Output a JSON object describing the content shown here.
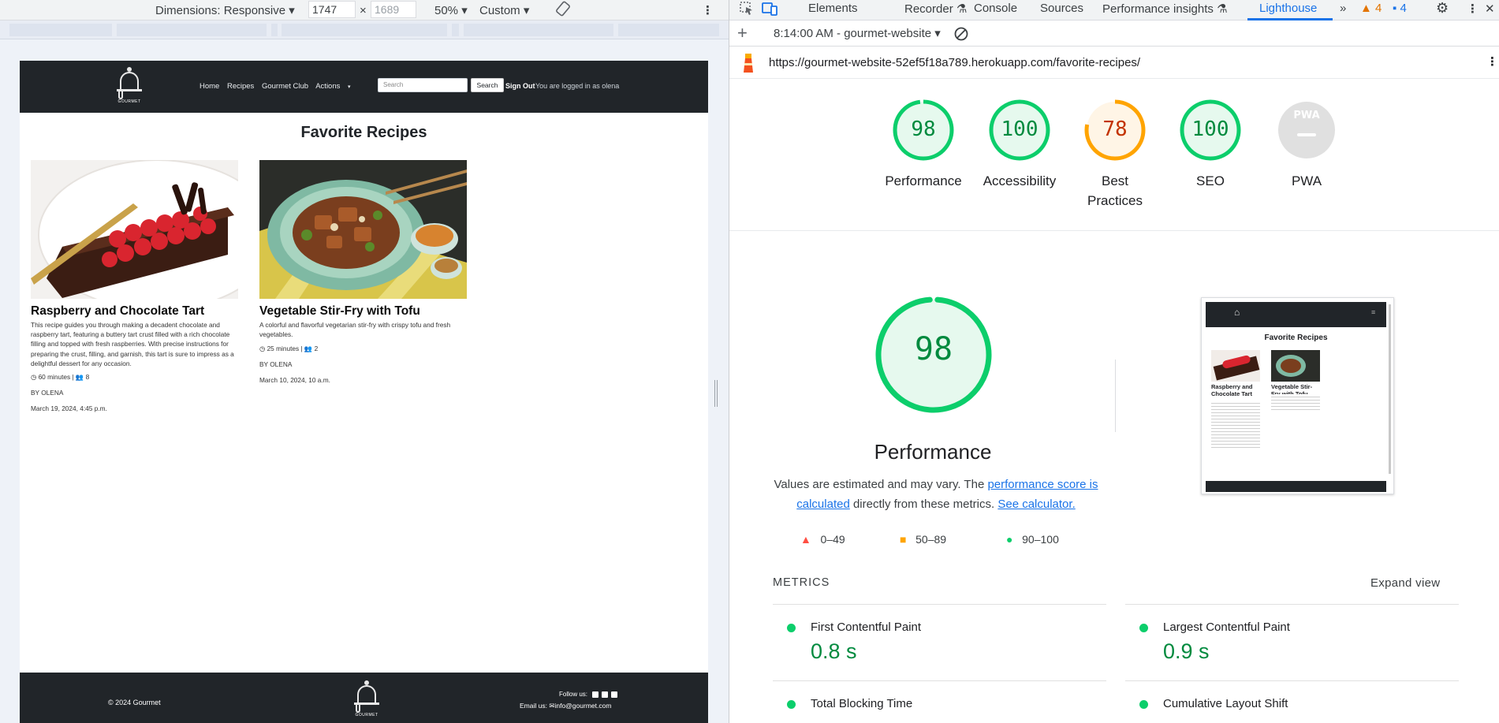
{
  "device_toolbar": {
    "dimensions_label": "Dimensions: Responsive",
    "width_value": "1747",
    "times": "×",
    "height_placeholder": "1689",
    "zoom": "50%",
    "throttle": "Custom"
  },
  "site": {
    "logo_text": "GOURMET",
    "nav": [
      "Home",
      "Recipes",
      "Gourmet Club",
      "Actions"
    ],
    "search_placeholder": "Search",
    "search_button": "Search",
    "sign_out": "Sign Out",
    "logged_in": "You are logged in as olena",
    "page_title": "Favorite Recipes",
    "recipes": [
      {
        "title": "Raspberry and Chocolate Tart",
        "description": "This recipe guides you through making a decadent chocolate and raspberry tart, featuring a buttery tart crust filled with a rich chocolate filling and topped with fresh raspberries. With precise instructions for preparing the crust, filling, and garnish, this tart is sure to impress as a delightful dessert for any occasion.",
        "time": "60 minutes",
        "servings": "8",
        "author": "BY OLENA",
        "date": "March 19, 2024, 4:45 p.m."
      },
      {
        "title": "Vegetable Stir-Fry with Tofu",
        "description": "A colorful and flavorful vegetarian stir-fry with crispy tofu and fresh vegetables.",
        "time": "25 minutes",
        "servings": "2",
        "author": "BY OLENA",
        "date": "March 10, 2024, 10 a.m."
      }
    ],
    "footer_copy": "© 2024 Gourmet",
    "footer_follow": "Follow us:",
    "footer_email_label": "Email us:",
    "footer_email": "info@gourmet.com"
  },
  "devtools": {
    "tabs": [
      "Elements",
      "Recorder",
      "Console",
      "Sources",
      "Performance insights",
      "Lighthouse"
    ],
    "warnings_count": "4",
    "messages_count": "4",
    "report_time": "8:14:00 AM - gourmet-website",
    "url": "https://gourmet-website-52ef5f18a789.herokuapp.com/favorite-recipes/",
    "scores": [
      {
        "label": "Performance",
        "value": "98",
        "score": 98,
        "status": "pass"
      },
      {
        "label": "Accessibility",
        "value": "100",
        "score": 100,
        "status": "pass"
      },
      {
        "label": "Best Practices",
        "value": "78",
        "score": 78,
        "status": "average"
      },
      {
        "label": "SEO",
        "value": "100",
        "score": 100,
        "status": "pass"
      },
      {
        "label": "PWA",
        "value": "PWA",
        "score": null,
        "status": "na"
      }
    ],
    "performance": {
      "score": "98",
      "title": "Performance",
      "note_prefix": "Values are estimated and may vary. The ",
      "note_link1": "performance score is calculated",
      "note_middle": " directly from these metrics. ",
      "note_link2": "See calculator.",
      "legend": [
        "0–49",
        "50–89",
        "90–100"
      ],
      "thumb_title": "Favorite Recipes",
      "thumb_r1": "Raspberry and Chocolate Tart",
      "thumb_r2": "Vegetable Stir-Fry with Tofu"
    },
    "metrics_header": "METRICS",
    "expand_view": "Expand view",
    "metrics": [
      {
        "name": "First Contentful Paint",
        "value": "0.8 s"
      },
      {
        "name": "Largest Contentful Paint",
        "value": "0.9 s"
      },
      {
        "name": "Total Blocking Time",
        "value": ""
      },
      {
        "name": "Cumulative Layout Shift",
        "value": ""
      }
    ],
    "colors": {
      "pass": "#0cce6b",
      "pass_text": "#008a3e",
      "average": "#ffa400",
      "average_text": "#c33300",
      "fail": "#ff4e42",
      "accent": "#1a73e8"
    }
  }
}
